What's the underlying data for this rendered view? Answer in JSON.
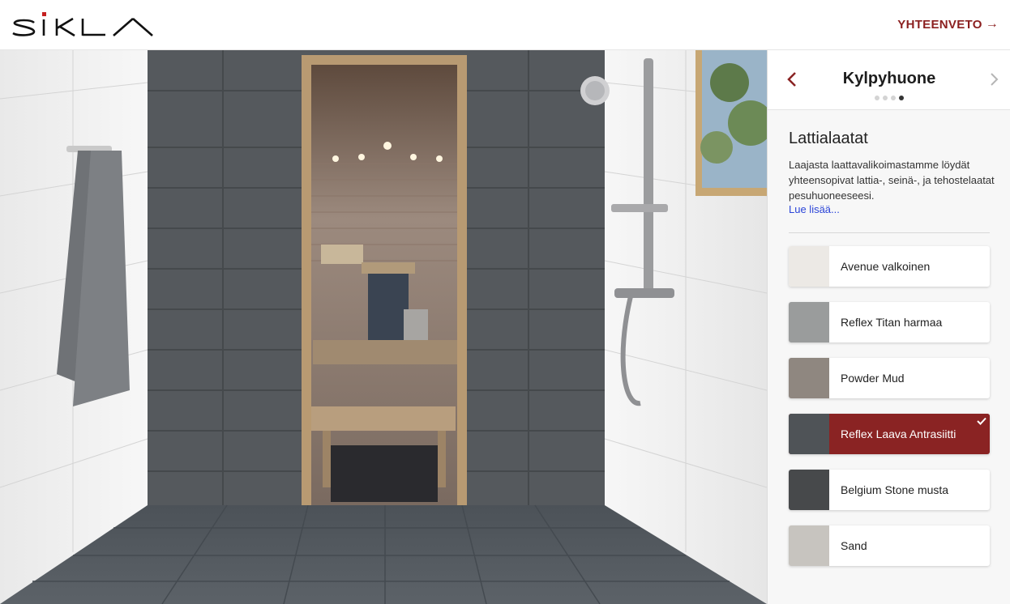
{
  "header": {
    "brand": "SIKLA",
    "summary_label": "YHTEENVETO",
    "summary_icon": "arrow-right-icon"
  },
  "panel": {
    "title": "Kylpyhuone",
    "step_count": 4,
    "active_step": 4,
    "section_title": "Lattialaatat",
    "description": "Laajasta laattavalikoimastamme löydät yhteensopivat lattia-, seinä-, ja tehostelaatat pesuhuoneeseesi.",
    "read_more": "Lue lisää...",
    "options": [
      {
        "label": "Avenue valkoinen",
        "swatch": "#ece9e5",
        "selected": false
      },
      {
        "label": "Reflex Titan harmaa",
        "swatch": "#9a9c9c",
        "selected": false
      },
      {
        "label": "Powder Mud",
        "swatch": "#8f8780",
        "selected": false
      },
      {
        "label": "Reflex Laava Antrasiitti",
        "swatch": "#4f5357",
        "selected": true
      },
      {
        "label": "Belgium Stone musta",
        "swatch": "#47494b",
        "selected": false
      },
      {
        "label": "Sand",
        "swatch": "#c7c4bf",
        "selected": false
      }
    ]
  },
  "colors": {
    "accent": "#8a2323",
    "link": "#2b45d8"
  }
}
